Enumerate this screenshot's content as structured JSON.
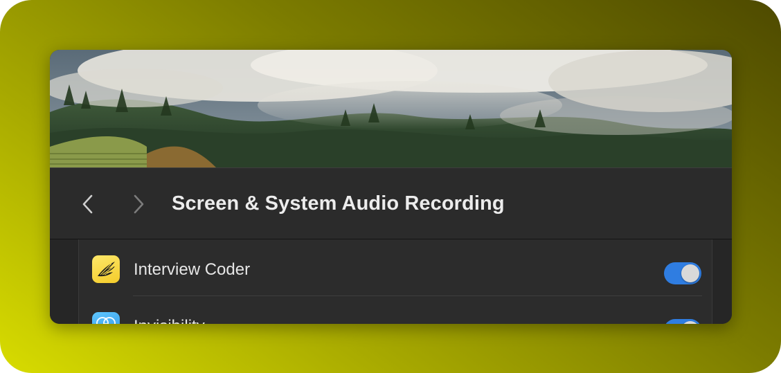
{
  "window": {
    "title": "Screen & System Audio Recording"
  },
  "navigation": {
    "back_icon": "chevron-left-icon",
    "forward_icon": "chevron-right-icon"
  },
  "apps": [
    {
      "name": "Interview Coder",
      "icon": "wing-icon",
      "enabled": true
    },
    {
      "name": "Invisibility",
      "icon": "bubbles-icon",
      "enabled": true
    }
  ],
  "colors": {
    "accent": "#2f7de1",
    "background_gradient": [
      "#d8dc00",
      "#4e4a00"
    ],
    "window_bg": "#2b2b2b"
  }
}
